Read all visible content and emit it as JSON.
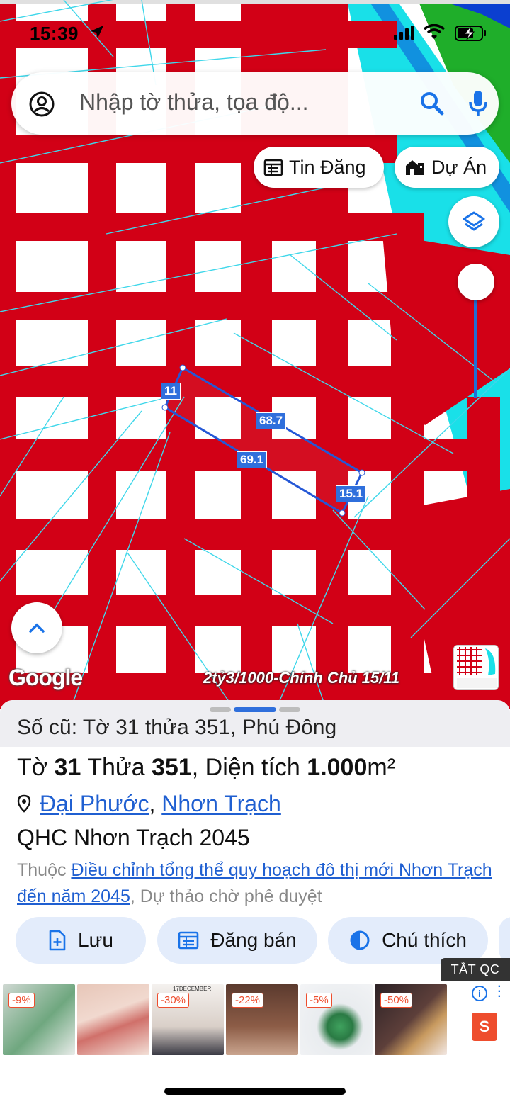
{
  "status_bar": {
    "time": "15:39"
  },
  "search": {
    "placeholder": "Nhập tờ thửa, tọa độ..."
  },
  "chips": {
    "listing": "Tin Đăng",
    "project": "Dự Án"
  },
  "map": {
    "attribution": "Google",
    "banner": "2tỷ3/1000-Chính Chủ 15/11",
    "measurements": {
      "left": "11",
      "top": "68.7",
      "bottom": "69.1",
      "right": "15.1"
    }
  },
  "sheet": {
    "old_record": "Số cũ: Tờ 31 thửa 351, Phú Đông",
    "title": {
      "sheet_label": "Tờ",
      "sheet_no": "31",
      "parcel_label": "Thửa",
      "parcel_no": "351",
      "area_label": ", Diện tích",
      "area_value": "1.000",
      "unit": "m²"
    },
    "address": {
      "ward": "Đại Phước",
      "district": "Nhơn Trạch",
      "separator": ","
    },
    "plan_name": "QHC Nhơn Trạch 2045",
    "plan_desc": {
      "prefix": "Thuộc",
      "link": "Điều chỉnh tổng thể quy hoạch đô thị mới Nhơn Trạch đến năm 2045",
      "suffix": ", Dự thảo chờ phê duyệt"
    },
    "actions": {
      "save": "Lưu",
      "sell": "Đăng bán",
      "legend": "Chú thích"
    }
  },
  "ads": {
    "close_label": "TẮT QC",
    "items": [
      {
        "badge": "-9%"
      },
      {
        "badge": ""
      },
      {
        "badge": "-30%",
        "caption": "17DECEMBER"
      },
      {
        "badge": "-22%"
      },
      {
        "badge": "-5%"
      },
      {
        "badge": "-50%"
      }
    ],
    "brand": "S"
  }
}
